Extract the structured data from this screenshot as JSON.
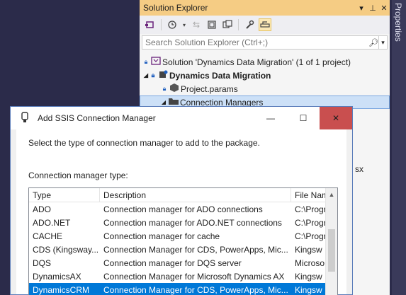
{
  "properties_tab": {
    "label": "Properties"
  },
  "solution_explorer": {
    "title": "Solution Explorer",
    "title_buttons": [
      "▾",
      "⊥",
      "✕"
    ],
    "search": {
      "placeholder": "Search Solution Explorer (Ctrl+;)"
    },
    "tree": [
      {
        "label": "Solution 'Dynamics Data Migration' (1 of 1 project)"
      },
      {
        "label": "Dynamics Data Migration"
      },
      {
        "label": "Project.params"
      },
      {
        "label": "Connection Managers"
      }
    ],
    "partial_text": "sx"
  },
  "dialog": {
    "title": "Add SSIS Connection Manager",
    "buttons": {
      "minimize": "—",
      "maximize": "☐",
      "close": "✕"
    },
    "instruction": "Select the type of connection manager to add to the package.",
    "list_label": "Connection manager type:",
    "columns": [
      "Type",
      "Description",
      "File Nam"
    ],
    "rows": [
      {
        "type": "ADO",
        "description": "Connection manager for ADO connections",
        "file": "C:\\Progr"
      },
      {
        "type": "ADO.NET",
        "description": "Connection manager for ADO.NET connections",
        "file": "C:\\Progr"
      },
      {
        "type": "CACHE",
        "description": "Connection manager for cache",
        "file": "C:\\Progr"
      },
      {
        "type": "CDS (Kingsway...",
        "description": "Connection Manager for CDS, PowerApps, Mic...",
        "file": "Kingsw"
      },
      {
        "type": "DQS",
        "description": "Connection manager for DQS server",
        "file": "Microso"
      },
      {
        "type": "DynamicsAX",
        "description": "Connection Manager for Microsoft Dynamics AX",
        "file": "Kingsw"
      },
      {
        "type": "DynamicsCRM",
        "description": "Connection Manager for CDS, PowerApps, Mic...",
        "file": "Kingsw"
      }
    ],
    "selected_row": 6
  }
}
